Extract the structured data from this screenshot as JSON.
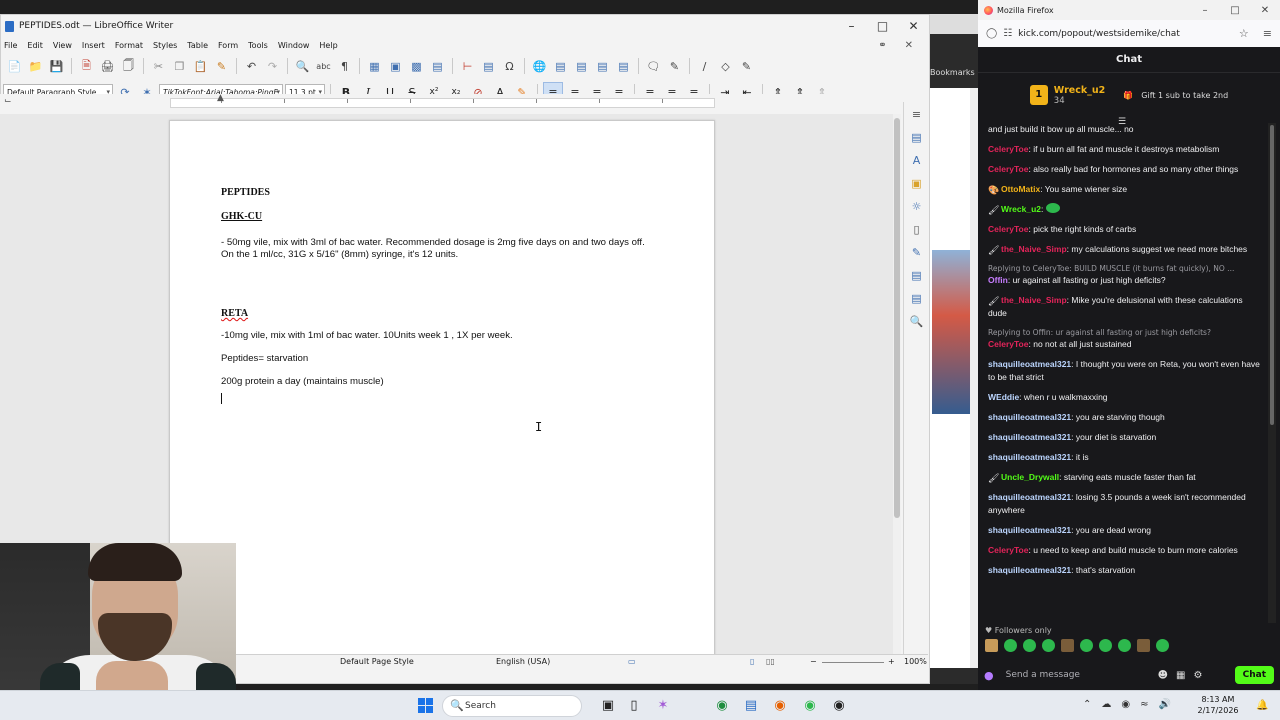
{
  "writer": {
    "title": "PEPTIDES.odt — LibreOffice Writer",
    "menu": [
      "File",
      "Edit",
      "View",
      "Insert",
      "Format",
      "Styles",
      "Table",
      "Form",
      "Tools",
      "Window",
      "Help"
    ],
    "paragraph_style": "Default Paragraph Style",
    "font_name": "TikTokFont;Arial;Tahoma;PingF",
    "font_size": "11.3 pt",
    "document": {
      "heading": "PEPTIDES",
      "section1_title": "GHK-CU",
      "section1_line1": "- 50mg vile, mix with 3ml of bac water. Recommended dosage is 2mg five days on and two days off.",
      "section1_line2": "On the 1 ml/cc, 31G x 5/16\" (8mm) syringe, it's 12 units.",
      "section2_title": "RETA",
      "section2_line1": "-10mg vile, mix with 1ml of bac water. 10Units week 1 , 1X per week.",
      "line_peptides": "Peptides= starvation",
      "line_protein": "200g protein a day (maintains muscle)"
    },
    "status": {
      "page_style": "Default Page Style",
      "language": "English (USA)",
      "zoom": "100%"
    }
  },
  "background_window": {
    "bookmarks_label": "Bookmarks"
  },
  "firefox": {
    "title": "Mozilla Firefox",
    "url": "kick.com/popout/westsidemike/chat",
    "chat_header": "Chat",
    "pinned": {
      "user": "Wreck_u2",
      "count": "34",
      "gift_text": "Gift 1 sub to take 2nd"
    },
    "messages": [
      {
        "reply": "",
        "user": "",
        "text": "and just build it bow up all muscle... no",
        "color": "#efeff1",
        "badge": ""
      },
      {
        "reply": "",
        "user": "CeleryToe",
        "text": "if u burn all fat and muscle it destroys metabolism",
        "color": "#e3245a",
        "badge": ""
      },
      {
        "reply": "",
        "user": "CeleryToe",
        "text": "also really bad for hormones and so many other things",
        "color": "#e3245a",
        "badge": ""
      },
      {
        "reply": "",
        "user": "OttoMatix",
        "text": "You same wiener size",
        "color": "#f2b319",
        "badge": "palette-icon"
      },
      {
        "reply": "",
        "user": "Wreck_u2",
        "text": "",
        "color": "#53fc18",
        "badge": "brush-icon"
      },
      {
        "reply": "",
        "user": "CeleryToe",
        "text": "pick the right kinds of carbs",
        "color": "#e3245a",
        "badge": ""
      },
      {
        "reply": "",
        "user": "the_Naive_Simp",
        "text": "my calculations suggest we need more bitches",
        "color": "#e3245a",
        "badge": "brush-icon"
      },
      {
        "reply": "Replying to CeleryToe: BUILD MUSCLE (it burns fat quickly), NO ...",
        "user": "Offin",
        "text": "ur against all fasting or just high deficits?",
        "color": "#c77dff",
        "badge": ""
      },
      {
        "reply": "",
        "user": "the_Naive_Simp",
        "text": "Mike you're delusional with these calculations dude",
        "color": "#e3245a",
        "badge": "brush-icon"
      },
      {
        "reply": "Replying to Offin: ur against all fasting or just high deficits?",
        "user": "CeleryToe",
        "text": "no not at all just sustained",
        "color": "#e3245a",
        "badge": ""
      },
      {
        "reply": "",
        "user": "shaquilleoatmeal321",
        "text": "I thought you were on Reta, you won't even have to be that strict",
        "color": "#bcd6ff",
        "badge": ""
      },
      {
        "reply": "",
        "user": "WEddie",
        "text": "when r u walkmaxxing",
        "color": "#bcd6ff",
        "badge": ""
      },
      {
        "reply": "",
        "user": "shaquilleoatmeal321",
        "text": "you are starving though",
        "color": "#bcd6ff",
        "badge": ""
      },
      {
        "reply": "",
        "user": "shaquilleoatmeal321",
        "text": "your diet is starvation",
        "color": "#bcd6ff",
        "badge": ""
      },
      {
        "reply": "",
        "user": "shaquilleoatmeal321",
        "text": "it is",
        "color": "#bcd6ff",
        "badge": ""
      },
      {
        "reply": "",
        "user": "Uncle_Drywall",
        "text": "starving eats muscle faster than fat",
        "color": "#53fc18",
        "badge": "brush-icon"
      },
      {
        "reply": "",
        "user": "shaquilleoatmeal321",
        "text": "losing 3.5 pounds a week isn't recommended anywhere",
        "color": "#bcd6ff",
        "badge": ""
      },
      {
        "reply": "",
        "user": "shaquilleoatmeal321",
        "text": "you are dead wrong",
        "color": "#bcd6ff",
        "badge": ""
      },
      {
        "reply": "",
        "user": "CeleryToe",
        "text": "u need to keep and build muscle to burn more calories",
        "color": "#e3245a",
        "badge": ""
      },
      {
        "reply": "",
        "user": "shaquilleoatmeal321",
        "text": "that's starvation",
        "color": "#bcd6ff",
        "badge": ""
      }
    ],
    "followers_only": "Followers only",
    "input_placeholder": "Send a message",
    "chat_button": "Chat"
  },
  "taskbar": {
    "search_label": "Search",
    "time": "8:13 AM",
    "date": "2/17/2026"
  }
}
